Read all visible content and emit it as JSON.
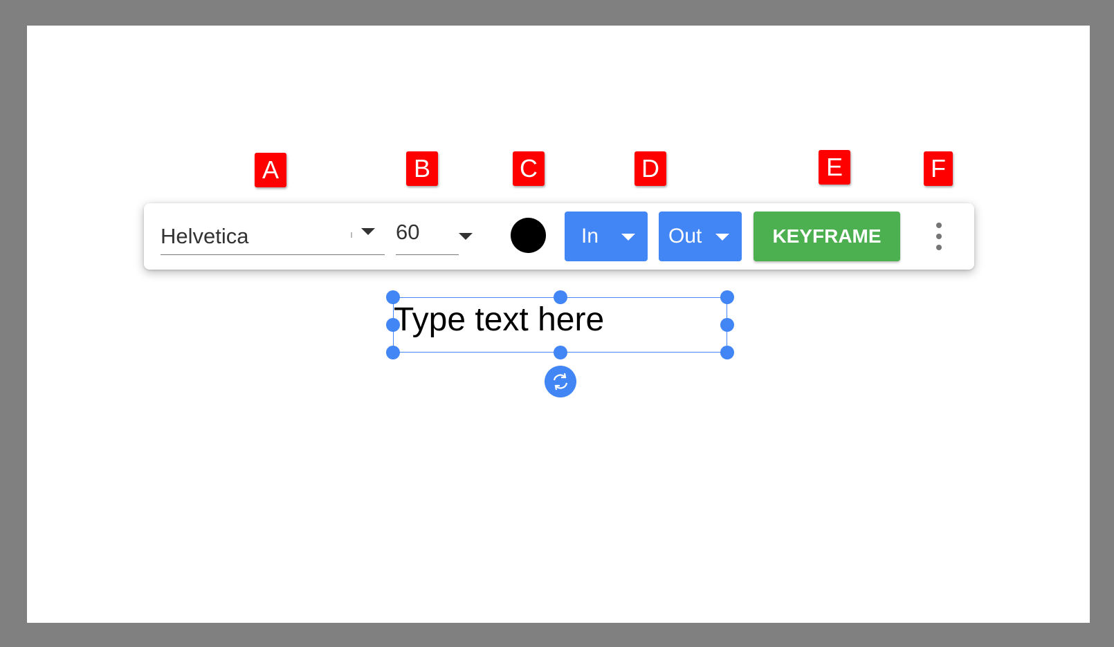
{
  "markers": [
    "A",
    "B",
    "C",
    "D",
    "E",
    "F"
  ],
  "toolbar": {
    "font_family": "Helvetica",
    "font_size": "60",
    "text_color": "#000000",
    "animation_in_label": "In",
    "animation_out_label": "Out",
    "keyframe_label": "KEYFRAME",
    "more_icon": "more-vert-icon"
  },
  "textbox": {
    "text": "Type text here"
  },
  "colors": {
    "accent": "#4285f4",
    "keyframe": "#4caf50",
    "marker": "#ff0000",
    "frame": "#808080"
  }
}
